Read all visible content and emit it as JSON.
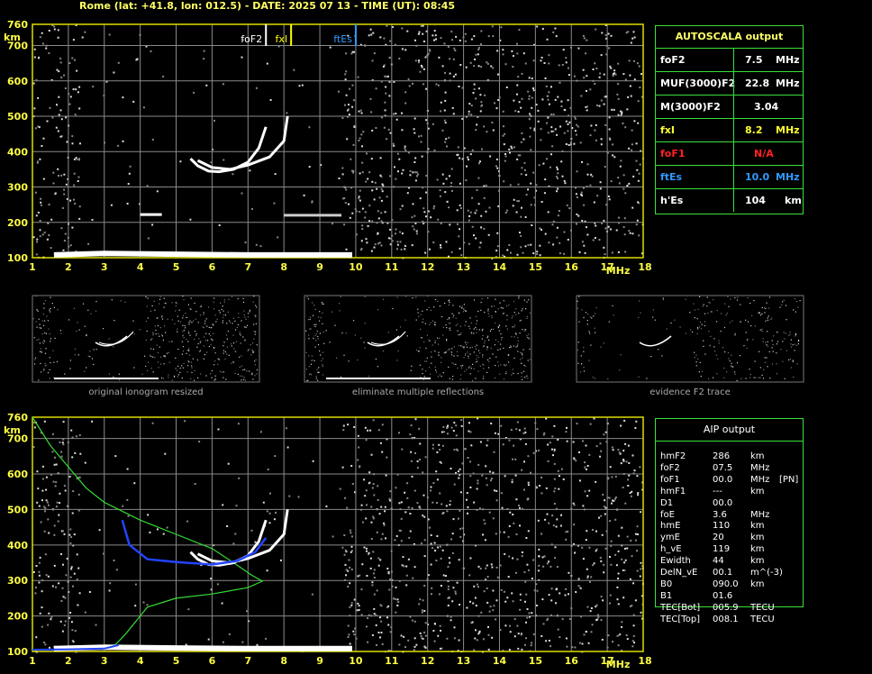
{
  "header": {
    "title": "Rome (lat: +41.8, lon: 012.5) - DATE: 2025 07 13 - TIME (UT): 08:45"
  },
  "chart_data": [
    {
      "type": "scatter",
      "name": "main-ionogram",
      "xlabel": "MHz",
      "ylabel": "km",
      "xlim": [
        1,
        18
      ],
      "ylim": [
        100,
        760
      ],
      "x_ticks": [
        "1",
        "2",
        "3",
        "4",
        "5",
        "6",
        "7",
        "8",
        "9",
        "10",
        "11",
        "12",
        "13",
        "14",
        "15",
        "16",
        "17",
        "18"
      ],
      "y_ticks": [
        "100",
        "200",
        "300",
        "400",
        "500",
        "600",
        "700",
        "760"
      ],
      "grid": true,
      "markers": [
        {
          "label": "foF2",
          "freq": 7.5,
          "color": "#ffffff"
        },
        {
          "label": "fxI",
          "freq": 8.2,
          "color": "#ffff00"
        },
        {
          "label": "ftEs",
          "freq": 10.0,
          "color": "#3399ff"
        }
      ],
      "traces": {
        "o_trace": [
          [
            5.4,
            380
          ],
          [
            5.6,
            360
          ],
          [
            5.9,
            345
          ],
          [
            6.2,
            343
          ],
          [
            6.6,
            350
          ],
          [
            7.0,
            370
          ],
          [
            7.3,
            410
          ],
          [
            7.5,
            470
          ]
        ],
        "x_trace": [
          [
            5.6,
            375
          ],
          [
            6.0,
            355
          ],
          [
            6.5,
            350
          ],
          [
            7.0,
            362
          ],
          [
            7.6,
            385
          ],
          [
            8.0,
            430
          ],
          [
            8.1,
            500
          ]
        ],
        "es_trace": [
          [
            1.6,
            108
          ],
          [
            3,
            112
          ],
          [
            5,
            110
          ],
          [
            7,
            108
          ],
          [
            9.9,
            108
          ]
        ],
        "e_small": [
          [
            4,
            222
          ],
          [
            4.6,
            222
          ]
        ],
        "hr_trace": [
          [
            8,
            220
          ],
          [
            9.6,
            220
          ]
        ]
      }
    },
    {
      "type": "scatter",
      "name": "aip-ionogram",
      "xlabel": "MHz",
      "ylabel": "km",
      "xlim": [
        1,
        18
      ],
      "ylim": [
        100,
        760
      ],
      "x_ticks": [
        "1",
        "2",
        "3",
        "4",
        "5",
        "6",
        "7",
        "8",
        "9",
        "10",
        "11",
        "12",
        "13",
        "14",
        "15",
        "16",
        "17",
        "18"
      ],
      "y_ticks": [
        "100",
        "200",
        "300",
        "400",
        "500",
        "600",
        "700",
        "760"
      ],
      "grid": true,
      "traces": {
        "profile_green": [
          [
            1,
            760
          ],
          [
            1.5,
            680
          ],
          [
            2,
            620
          ],
          [
            2.5,
            560
          ],
          [
            3,
            520
          ],
          [
            4,
            470
          ],
          [
            5,
            430
          ],
          [
            6,
            390
          ],
          [
            6.6,
            350
          ],
          [
            7.1,
            315
          ],
          [
            7.4,
            298
          ],
          [
            7.0,
            280
          ],
          [
            6,
            262
          ],
          [
            5,
            250
          ],
          [
            4.2,
            225
          ],
          [
            3.6,
            150
          ],
          [
            3.3,
            118
          ],
          [
            2.5,
            108
          ],
          [
            1,
            104
          ]
        ],
        "model_blue": [
          [
            3.5,
            470
          ],
          [
            3.7,
            400
          ],
          [
            4.2,
            360
          ],
          [
            5,
            352
          ],
          [
            6,
            345
          ],
          [
            6.7,
            355
          ],
          [
            7.2,
            380
          ],
          [
            7.5,
            420
          ]
        ],
        "model_blue_low": [
          [
            1,
            105
          ],
          [
            2,
            106
          ],
          [
            3,
            108
          ],
          [
            3.4,
            118
          ]
        ],
        "o_trace": [
          [
            5.4,
            380
          ],
          [
            5.6,
            360
          ],
          [
            5.9,
            345
          ],
          [
            6.2,
            343
          ],
          [
            6.6,
            350
          ],
          [
            7.0,
            370
          ],
          [
            7.3,
            410
          ],
          [
            7.5,
            470
          ]
        ],
        "x_trace": [
          [
            5.6,
            375
          ],
          [
            6.0,
            355
          ],
          [
            6.5,
            350
          ],
          [
            7.0,
            362
          ],
          [
            7.6,
            385
          ],
          [
            8.0,
            430
          ],
          [
            8.1,
            500
          ]
        ],
        "es_trace": [
          [
            1.6,
            108
          ],
          [
            3,
            112
          ],
          [
            5,
            110
          ],
          [
            7,
            108
          ],
          [
            9.9,
            108
          ]
        ]
      }
    }
  ],
  "thumbnails": [
    {
      "caption": "original ionogram resized"
    },
    {
      "caption": "eliminate multiple reflections"
    },
    {
      "caption": "evidence F2 trace"
    }
  ],
  "autoscala": {
    "title": "AUTOSCALA output",
    "rows": [
      {
        "label": "foF2",
        "value": "7.5",
        "unit": "MHz",
        "color": "#ffffff"
      },
      {
        "label": "MUF(3000)F2",
        "value": "22.8",
        "unit": "MHz",
        "color": "#ffffff"
      },
      {
        "label": "M(3000)F2",
        "value": "3.04",
        "unit": "",
        "color": "#ffffff"
      },
      {
        "label": "fxI",
        "value": "8.2",
        "unit": "MHz",
        "color": "#ffff33"
      },
      {
        "label": "foF1",
        "value": "N/A",
        "unit": "",
        "color": "#ff2222"
      },
      {
        "label": "ftEs",
        "value": "10.0",
        "unit": "MHz",
        "color": "#3399ff"
      },
      {
        "label": "h'Es",
        "value": "104",
        "unit": "km",
        "color": "#ffffff"
      }
    ]
  },
  "aip": {
    "title": "AIP output",
    "rows": [
      {
        "label": "hmF2",
        "value": "286",
        "unit": "km",
        "extra": ""
      },
      {
        "label": "foF2",
        "value": "07.5",
        "unit": "MHz",
        "extra": ""
      },
      {
        "label": "foF1",
        "value": "00.0",
        "unit": "MHz",
        "extra": "[PN]"
      },
      {
        "label": "hmF1",
        "value": "---",
        "unit": "km",
        "extra": ""
      },
      {
        "label": "D1",
        "value": "00.0",
        "unit": "",
        "extra": ""
      },
      {
        "label": "foE",
        "value": "3.6",
        "unit": "MHz",
        "extra": ""
      },
      {
        "label": "hmE",
        "value": "110",
        "unit": "km",
        "extra": ""
      },
      {
        "label": "ymE",
        "value": "20",
        "unit": "km",
        "extra": ""
      },
      {
        "label": "h_vE",
        "value": "119",
        "unit": "km",
        "extra": ""
      },
      {
        "label": "Ewidth",
        "value": "44",
        "unit": "km",
        "extra": ""
      },
      {
        "label": "DelN_vE",
        "value": "00.1",
        "unit": "m^(-3)",
        "extra": ""
      },
      {
        "label": "B0",
        "value": "090.0",
        "unit": "km",
        "extra": ""
      },
      {
        "label": "B1",
        "value": "01.6",
        "unit": "",
        "extra": ""
      },
      {
        "label": "TEC[Bot]",
        "value": "005.9",
        "unit": "TECU",
        "extra": ""
      },
      {
        "label": "TEC[Top]",
        "value": "008.1",
        "unit": "TECU",
        "extra": ""
      }
    ]
  }
}
